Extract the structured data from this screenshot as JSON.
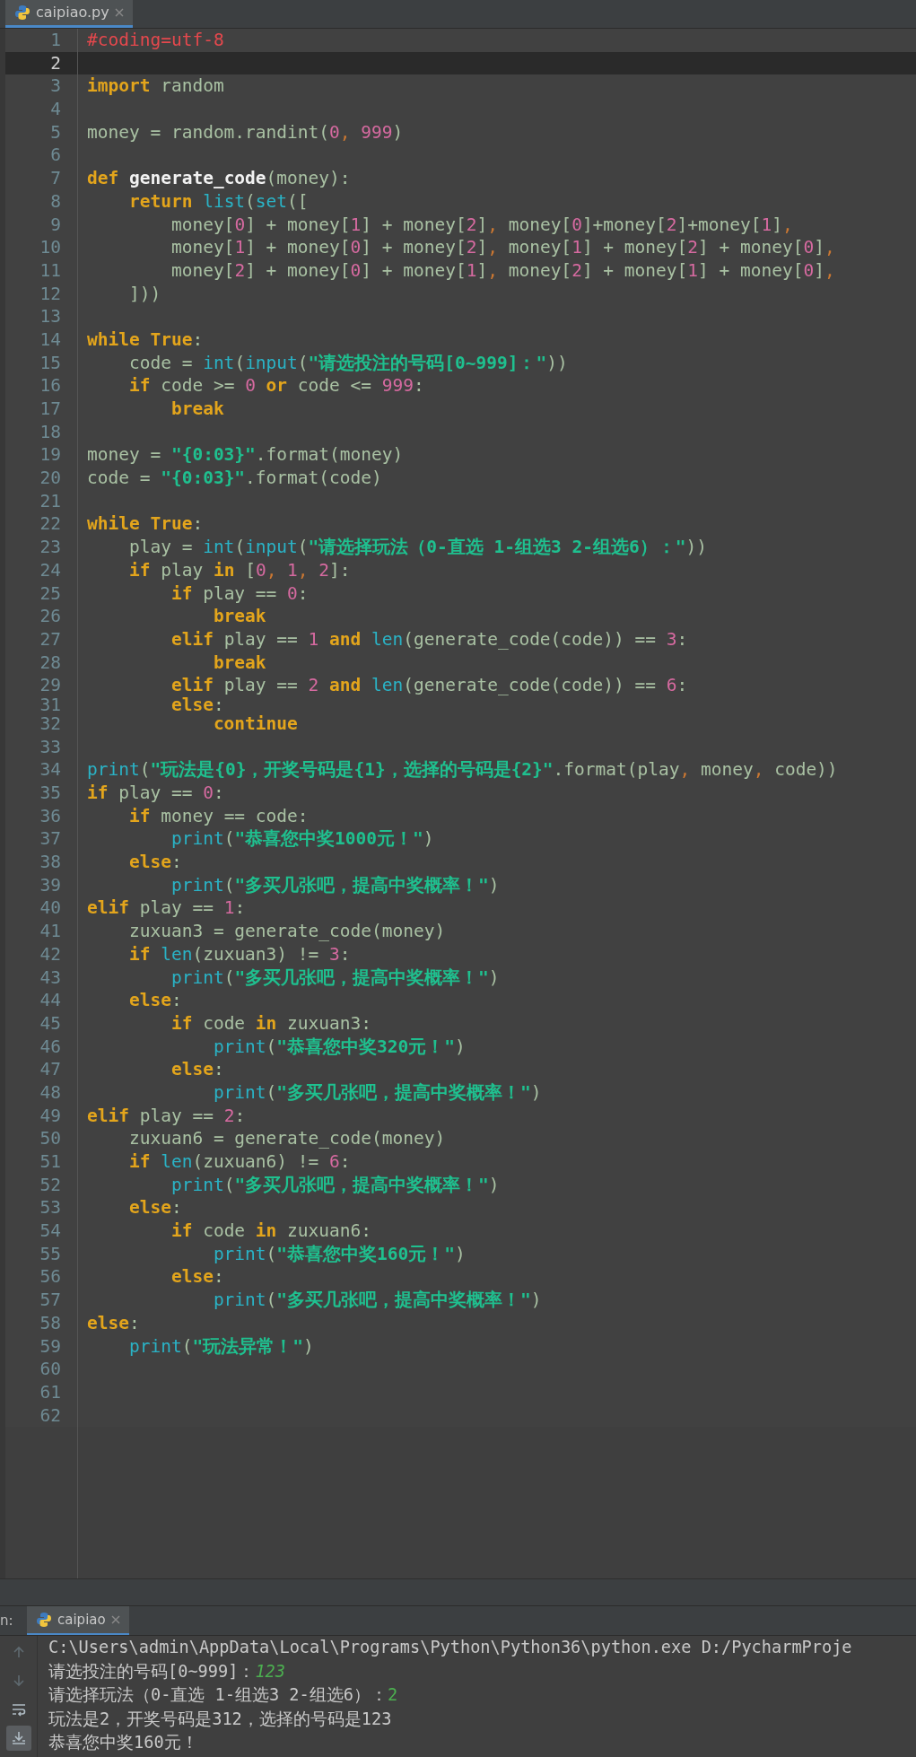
{
  "editor": {
    "tab": {
      "label": "caipiao.py",
      "selected": true
    },
    "lines": [
      {
        "n": "1",
        "current": false,
        "kind": "normal",
        "tokens": [
          {
            "kind": "comment",
            "text": "#coding=utf-8"
          }
        ]
      },
      {
        "n": "2",
        "current": true,
        "kind": "normal"
      },
      {
        "n": "3",
        "current": false,
        "kind": "normal",
        "tokens": [
          {
            "kind": "keyword",
            "text": "import"
          },
          {
            "kind": "plain",
            "text": " random"
          }
        ]
      },
      {
        "n": "4",
        "current": false,
        "kind": "normal"
      },
      {
        "n": "5",
        "current": false,
        "kind": "normal",
        "tokens": [
          {
            "kind": "plain",
            "text": "money = random.randint("
          },
          {
            "kind": "number",
            "text": "0"
          },
          {
            "kind": "comma",
            "text": ", "
          },
          {
            "kind": "number",
            "text": "999"
          },
          {
            "kind": "plain",
            "text": ")"
          }
        ]
      },
      {
        "n": "6",
        "current": false,
        "kind": "normal"
      },
      {
        "n": "7",
        "current": false,
        "kind": "normal",
        "tokens": [
          {
            "kind": "keyword",
            "text": "def"
          },
          {
            "kind": "defname",
            "text": " generate_code"
          },
          {
            "kind": "plain",
            "text": "(money):"
          }
        ]
      },
      {
        "n": "8",
        "current": false,
        "kind": "normal",
        "tokens": [
          {
            "kind": "keyword",
            "text": "    return"
          },
          {
            "kind": "builtin",
            "text": " list"
          },
          {
            "kind": "plain",
            "text": "("
          },
          {
            "kind": "builtin",
            "text": "set"
          },
          {
            "kind": "plain",
            "text": "(["
          }
        ]
      },
      {
        "n": "9",
        "current": false,
        "kind": "normal",
        "tokens": [
          {
            "kind": "plain",
            "text": "        money["
          },
          {
            "kind": "number",
            "text": "0"
          },
          {
            "kind": "plain",
            "text": "] + money["
          },
          {
            "kind": "number",
            "text": "1"
          },
          {
            "kind": "plain",
            "text": "] + money["
          },
          {
            "kind": "number",
            "text": "2"
          },
          {
            "kind": "plain",
            "text": "]"
          },
          {
            "kind": "comma",
            "text": ", "
          },
          {
            "kind": "plain",
            "text": "money["
          },
          {
            "kind": "number",
            "text": "0"
          },
          {
            "kind": "plain",
            "text": "]+money["
          },
          {
            "kind": "number",
            "text": "2"
          },
          {
            "kind": "plain",
            "text": "]+money["
          },
          {
            "kind": "number",
            "text": "1"
          },
          {
            "kind": "plain",
            "text": "]"
          },
          {
            "kind": "comma",
            "text": ","
          }
        ]
      },
      {
        "n": "10",
        "current": false,
        "kind": "normal",
        "tokens": [
          {
            "kind": "plain",
            "text": "        money["
          },
          {
            "kind": "number",
            "text": "1"
          },
          {
            "kind": "plain",
            "text": "] + money["
          },
          {
            "kind": "number",
            "text": "0"
          },
          {
            "kind": "plain",
            "text": "] + money["
          },
          {
            "kind": "number",
            "text": "2"
          },
          {
            "kind": "plain",
            "text": "]"
          },
          {
            "kind": "comma",
            "text": ", "
          },
          {
            "kind": "plain",
            "text": "money["
          },
          {
            "kind": "number",
            "text": "1"
          },
          {
            "kind": "plain",
            "text": "] + money["
          },
          {
            "kind": "number",
            "text": "2"
          },
          {
            "kind": "plain",
            "text": "] + money["
          },
          {
            "kind": "number",
            "text": "0"
          },
          {
            "kind": "plain",
            "text": "]"
          },
          {
            "kind": "comma",
            "text": ","
          }
        ]
      },
      {
        "n": "11",
        "current": false,
        "kind": "normal",
        "tokens": [
          {
            "kind": "plain",
            "text": "        money["
          },
          {
            "kind": "number",
            "text": "2"
          },
          {
            "kind": "plain",
            "text": "] + money["
          },
          {
            "kind": "number",
            "text": "0"
          },
          {
            "kind": "plain",
            "text": "] + money["
          },
          {
            "kind": "number",
            "text": "1"
          },
          {
            "kind": "plain",
            "text": "]"
          },
          {
            "kind": "comma",
            "text": ", "
          },
          {
            "kind": "plain",
            "text": "money["
          },
          {
            "kind": "number",
            "text": "2"
          },
          {
            "kind": "plain",
            "text": "] + money["
          },
          {
            "kind": "number",
            "text": "1"
          },
          {
            "kind": "plain",
            "text": "] + money["
          },
          {
            "kind": "number",
            "text": "0"
          },
          {
            "kind": "plain",
            "text": "]"
          },
          {
            "kind": "comma",
            "text": ","
          }
        ]
      },
      {
        "n": "12",
        "current": false,
        "kind": "normal",
        "tokens": [
          {
            "kind": "plain",
            "text": "    ]))"
          }
        ]
      },
      {
        "n": "13",
        "current": false,
        "kind": "normal"
      },
      {
        "n": "14",
        "current": false,
        "kind": "normal",
        "tokens": [
          {
            "kind": "keyword",
            "text": "while"
          },
          {
            "kind": "keyword",
            "text": " True"
          },
          {
            "kind": "plain",
            "text": ":"
          }
        ]
      },
      {
        "n": "15",
        "current": false,
        "kind": "normal",
        "tokens": [
          {
            "kind": "plain",
            "text": "    code = "
          },
          {
            "kind": "builtin",
            "text": "int"
          },
          {
            "kind": "plain",
            "text": "("
          },
          {
            "kind": "builtin",
            "text": "input"
          },
          {
            "kind": "plain",
            "text": "("
          },
          {
            "kind": "string",
            "text": "\"请选投注的号码[0~999]：\""
          },
          {
            "kind": "plain",
            "text": "))"
          }
        ]
      },
      {
        "n": "16",
        "current": false,
        "kind": "normal",
        "tokens": [
          {
            "kind": "keyword",
            "text": "    if"
          },
          {
            "kind": "plain",
            "text": " code >= "
          },
          {
            "kind": "number",
            "text": "0"
          },
          {
            "kind": "keyword",
            "text": " or"
          },
          {
            "kind": "plain",
            "text": " code <= "
          },
          {
            "kind": "number",
            "text": "999"
          },
          {
            "kind": "plain",
            "text": ":"
          }
        ]
      },
      {
        "n": "17",
        "current": false,
        "kind": "normal",
        "tokens": [
          {
            "kind": "keyword",
            "text": "        break"
          }
        ]
      },
      {
        "n": "18",
        "current": false,
        "kind": "normal"
      },
      {
        "n": "19",
        "current": false,
        "kind": "normal",
        "tokens": [
          {
            "kind": "plain",
            "text": "money = "
          },
          {
            "kind": "string",
            "text": "\"{0:03}\""
          },
          {
            "kind": "plain",
            "text": ".format(money)"
          }
        ]
      },
      {
        "n": "20",
        "current": false,
        "kind": "normal",
        "tokens": [
          {
            "kind": "plain",
            "text": "code = "
          },
          {
            "kind": "string",
            "text": "\"{0:03}\""
          },
          {
            "kind": "plain",
            "text": ".format(code)"
          }
        ]
      },
      {
        "n": "21",
        "current": false,
        "kind": "normal"
      },
      {
        "n": "22",
        "current": false,
        "kind": "normal",
        "tokens": [
          {
            "kind": "keyword",
            "text": "while"
          },
          {
            "kind": "keyword",
            "text": " True"
          },
          {
            "kind": "plain",
            "text": ":"
          }
        ]
      },
      {
        "n": "23",
        "current": false,
        "kind": "normal",
        "tokens": [
          {
            "kind": "plain",
            "text": "    play = "
          },
          {
            "kind": "builtin",
            "text": "int"
          },
          {
            "kind": "plain",
            "text": "("
          },
          {
            "kind": "builtin",
            "text": "input"
          },
          {
            "kind": "plain",
            "text": "("
          },
          {
            "kind": "string",
            "text": "\"请选择玩法（0-直选 1-组选3 2-组选6）：\""
          },
          {
            "kind": "plain",
            "text": "))"
          }
        ]
      },
      {
        "n": "24",
        "current": false,
        "kind": "normal",
        "tokens": [
          {
            "kind": "keyword",
            "text": "    if"
          },
          {
            "kind": "plain",
            "text": " play "
          },
          {
            "kind": "keyword",
            "text": "in"
          },
          {
            "kind": "plain",
            "text": " ["
          },
          {
            "kind": "number",
            "text": "0"
          },
          {
            "kind": "comma",
            "text": ", "
          },
          {
            "kind": "number",
            "text": "1"
          },
          {
            "kind": "comma",
            "text": ", "
          },
          {
            "kind": "number",
            "text": "2"
          },
          {
            "kind": "plain",
            "text": "]:"
          }
        ]
      },
      {
        "n": "25",
        "current": false,
        "kind": "normal",
        "tokens": [
          {
            "kind": "keyword",
            "text": "        if"
          },
          {
            "kind": "plain",
            "text": " play == "
          },
          {
            "kind": "number",
            "text": "0"
          },
          {
            "kind": "plain",
            "text": ":"
          }
        ]
      },
      {
        "n": "26",
        "current": false,
        "kind": "normal",
        "tokens": [
          {
            "kind": "keyword",
            "text": "            break"
          }
        ]
      },
      {
        "n": "27",
        "current": false,
        "kind": "normal",
        "tokens": [
          {
            "kind": "keyword",
            "text": "        elif"
          },
          {
            "kind": "plain",
            "text": " play == "
          },
          {
            "kind": "number",
            "text": "1"
          },
          {
            "kind": "keyword",
            "text": " and"
          },
          {
            "kind": "builtin",
            "text": " len"
          },
          {
            "kind": "plain",
            "text": "(generate_code(code)) == "
          },
          {
            "kind": "number",
            "text": "3"
          },
          {
            "kind": "plain",
            "text": ":"
          }
        ]
      },
      {
        "n": "28",
        "current": false,
        "kind": "normal",
        "tokens": [
          {
            "kind": "keyword",
            "text": "            break"
          }
        ]
      },
      {
        "n": "29",
        "current": false,
        "kind": "normal",
        "tokens": [
          {
            "kind": "keyword",
            "text": "        elif"
          },
          {
            "kind": "plain",
            "text": " play == "
          },
          {
            "kind": "number",
            "text": "2"
          },
          {
            "kind": "keyword",
            "text": " and"
          },
          {
            "kind": "builtin",
            "text": " len"
          },
          {
            "kind": "plain",
            "text": "(generate_code(code)) == "
          },
          {
            "kind": "number",
            "text": "6"
          },
          {
            "kind": "plain",
            "text": ":"
          }
        ]
      },
      {
        "n": "31",
        "current": false,
        "kind": "squeezed",
        "tokens": [
          {
            "kind": "keyword",
            "text": "        else"
          },
          {
            "kind": "plain",
            "text": ":"
          }
        ]
      },
      {
        "n": "32",
        "current": false,
        "kind": "normal",
        "tokens": [
          {
            "kind": "keyword",
            "text": "            continue"
          }
        ]
      },
      {
        "n": "33",
        "current": false,
        "kind": "normal"
      },
      {
        "n": "34",
        "current": false,
        "kind": "normal",
        "tokens": [
          {
            "kind": "builtin",
            "text": "print"
          },
          {
            "kind": "plain",
            "text": "("
          },
          {
            "kind": "string",
            "text": "\"玩法是{0}，开奖号码是{1}，选择的号码是{2}\""
          },
          {
            "kind": "plain",
            "text": ".format(play"
          },
          {
            "kind": "comma",
            "text": ", "
          },
          {
            "kind": "plain",
            "text": "money"
          },
          {
            "kind": "comma",
            "text": ", "
          },
          {
            "kind": "plain",
            "text": "code))"
          }
        ]
      },
      {
        "n": "35",
        "current": false,
        "kind": "normal",
        "tokens": [
          {
            "kind": "keyword",
            "text": "if"
          },
          {
            "kind": "plain",
            "text": " play == "
          },
          {
            "kind": "number",
            "text": "0"
          },
          {
            "kind": "plain",
            "text": ":"
          }
        ]
      },
      {
        "n": "36",
        "current": false,
        "kind": "normal",
        "tokens": [
          {
            "kind": "keyword",
            "text": "    if"
          },
          {
            "kind": "plain",
            "text": " money == code:"
          }
        ]
      },
      {
        "n": "37",
        "current": false,
        "kind": "normal",
        "tokens": [
          {
            "kind": "builtin",
            "text": "        print"
          },
          {
            "kind": "plain",
            "text": "("
          },
          {
            "kind": "string",
            "text": "\"恭喜您中奖1000元！\""
          },
          {
            "kind": "plain",
            "text": ")"
          }
        ]
      },
      {
        "n": "38",
        "current": false,
        "kind": "normal",
        "tokens": [
          {
            "kind": "keyword",
            "text": "    else"
          },
          {
            "kind": "plain",
            "text": ":"
          }
        ]
      },
      {
        "n": "39",
        "current": false,
        "kind": "normal",
        "tokens": [
          {
            "kind": "builtin",
            "text": "        print"
          },
          {
            "kind": "plain",
            "text": "("
          },
          {
            "kind": "string",
            "text": "\"多买几张吧，提高中奖概率！\""
          },
          {
            "kind": "plain",
            "text": ")"
          }
        ]
      },
      {
        "n": "40",
        "current": false,
        "kind": "normal",
        "tokens": [
          {
            "kind": "keyword",
            "text": "elif"
          },
          {
            "kind": "plain",
            "text": " play == "
          },
          {
            "kind": "number",
            "text": "1"
          },
          {
            "kind": "plain",
            "text": ":"
          }
        ]
      },
      {
        "n": "41",
        "current": false,
        "kind": "normal",
        "tokens": [
          {
            "kind": "plain",
            "text": "    zuxuan3 = generate_code(money)"
          }
        ]
      },
      {
        "n": "42",
        "current": false,
        "kind": "normal",
        "tokens": [
          {
            "kind": "keyword",
            "text": "    if"
          },
          {
            "kind": "builtin",
            "text": " len"
          },
          {
            "kind": "plain",
            "text": "(zuxuan3) != "
          },
          {
            "kind": "number",
            "text": "3"
          },
          {
            "kind": "plain",
            "text": ":"
          }
        ]
      },
      {
        "n": "43",
        "current": false,
        "kind": "normal",
        "tokens": [
          {
            "kind": "builtin",
            "text": "        print"
          },
          {
            "kind": "plain",
            "text": "("
          },
          {
            "kind": "string",
            "text": "\"多买几张吧，提高中奖概率！\""
          },
          {
            "kind": "plain",
            "text": ")"
          }
        ]
      },
      {
        "n": "44",
        "current": false,
        "kind": "normal",
        "tokens": [
          {
            "kind": "keyword",
            "text": "    else"
          },
          {
            "kind": "plain",
            "text": ":"
          }
        ]
      },
      {
        "n": "45",
        "current": false,
        "kind": "normal",
        "tokens": [
          {
            "kind": "keyword",
            "text": "        if"
          },
          {
            "kind": "plain",
            "text": " code "
          },
          {
            "kind": "keyword",
            "text": "in"
          },
          {
            "kind": "plain",
            "text": " zuxuan3:"
          }
        ]
      },
      {
        "n": "46",
        "current": false,
        "kind": "normal",
        "tokens": [
          {
            "kind": "builtin",
            "text": "            print"
          },
          {
            "kind": "plain",
            "text": "("
          },
          {
            "kind": "string",
            "text": "\"恭喜您中奖320元！\""
          },
          {
            "kind": "plain",
            "text": ")"
          }
        ]
      },
      {
        "n": "47",
        "current": false,
        "kind": "normal",
        "tokens": [
          {
            "kind": "keyword",
            "text": "        else"
          },
          {
            "kind": "plain",
            "text": ":"
          }
        ]
      },
      {
        "n": "48",
        "current": false,
        "kind": "normal",
        "tokens": [
          {
            "kind": "builtin",
            "text": "            print"
          },
          {
            "kind": "plain",
            "text": "("
          },
          {
            "kind": "string",
            "text": "\"多买几张吧，提高中奖概率！\""
          },
          {
            "kind": "plain",
            "text": ")"
          }
        ]
      },
      {
        "n": "49",
        "current": false,
        "kind": "normal",
        "tokens": [
          {
            "kind": "keyword",
            "text": "elif"
          },
          {
            "kind": "plain",
            "text": " play == "
          },
          {
            "kind": "number",
            "text": "2"
          },
          {
            "kind": "plain",
            "text": ":"
          }
        ]
      },
      {
        "n": "50",
        "current": false,
        "kind": "normal",
        "tokens": [
          {
            "kind": "plain",
            "text": "    zuxuan6 = generate_code(money)"
          }
        ]
      },
      {
        "n": "51",
        "current": false,
        "kind": "normal",
        "tokens": [
          {
            "kind": "keyword",
            "text": "    if"
          },
          {
            "kind": "builtin",
            "text": " len"
          },
          {
            "kind": "plain",
            "text": "(zuxuan6) != "
          },
          {
            "kind": "number",
            "text": "6"
          },
          {
            "kind": "plain",
            "text": ":"
          }
        ]
      },
      {
        "n": "52",
        "current": false,
        "kind": "normal",
        "tokens": [
          {
            "kind": "builtin",
            "text": "        print"
          },
          {
            "kind": "plain",
            "text": "("
          },
          {
            "kind": "string",
            "text": "\"多买几张吧，提高中奖概率！\""
          },
          {
            "kind": "plain",
            "text": ")"
          }
        ]
      },
      {
        "n": "53",
        "current": false,
        "kind": "normal",
        "tokens": [
          {
            "kind": "keyword",
            "text": "    else"
          },
          {
            "kind": "plain",
            "text": ":"
          }
        ]
      },
      {
        "n": "54",
        "current": false,
        "kind": "normal",
        "tokens": [
          {
            "kind": "keyword",
            "text": "        if"
          },
          {
            "kind": "plain",
            "text": " code "
          },
          {
            "kind": "keyword",
            "text": "in"
          },
          {
            "kind": "plain",
            "text": " zuxuan6:"
          }
        ]
      },
      {
        "n": "55",
        "current": false,
        "kind": "normal",
        "tokens": [
          {
            "kind": "builtin",
            "text": "            print"
          },
          {
            "kind": "plain",
            "text": "("
          },
          {
            "kind": "string",
            "text": "\"恭喜您中奖160元！\""
          },
          {
            "kind": "plain",
            "text": ")"
          }
        ]
      },
      {
        "n": "56",
        "current": false,
        "kind": "normal",
        "tokens": [
          {
            "kind": "keyword",
            "text": "        else"
          },
          {
            "kind": "plain",
            "text": ":"
          }
        ]
      },
      {
        "n": "57",
        "current": false,
        "kind": "normal",
        "tokens": [
          {
            "kind": "builtin",
            "text": "            print"
          },
          {
            "kind": "plain",
            "text": "("
          },
          {
            "kind": "string",
            "text": "\"多买几张吧，提高中奖概率！\""
          },
          {
            "kind": "plain",
            "text": ")"
          }
        ]
      },
      {
        "n": "58",
        "current": false,
        "kind": "normal",
        "tokens": [
          {
            "kind": "keyword",
            "text": "else"
          },
          {
            "kind": "plain",
            "text": ":"
          }
        ]
      },
      {
        "n": "59",
        "current": false,
        "kind": "normal",
        "tokens": [
          {
            "kind": "builtin",
            "text": "    print"
          },
          {
            "kind": "plain",
            "text": "("
          },
          {
            "kind": "string",
            "text": "\"玩法异常！\""
          },
          {
            "kind": "plain",
            "text": ")"
          }
        ]
      },
      {
        "n": "60",
        "current": false,
        "kind": "normal"
      },
      {
        "n": "61",
        "current": false,
        "kind": "normal"
      },
      {
        "n": "62",
        "current": false,
        "kind": "normal"
      }
    ]
  },
  "run_panel": {
    "label": "n:",
    "tab": {
      "label": "caipiao",
      "selected": true
    },
    "toolbar": [
      {
        "kind": "up",
        "disabled": true,
        "on": false
      },
      {
        "kind": "down",
        "disabled": true,
        "on": false
      },
      {
        "kind": "wrap",
        "disabled": false,
        "on": false
      },
      {
        "kind": "scroll_end",
        "disabled": false,
        "on": true
      }
    ],
    "console": [
      {
        "tokens": [
          {
            "kind": "output",
            "text": "C:\\Users\\admin\\AppData\\Local\\Programs\\Python\\Python36\\python.exe D:/PycharmProje"
          }
        ]
      },
      {
        "tokens": [
          {
            "kind": "output",
            "text": "请选投注的号码[0~999]："
          },
          {
            "kind": "input",
            "text": "123"
          }
        ]
      },
      {
        "tokens": [
          {
            "kind": "output",
            "text": "请选择玩法（0-直选 1-组选3 2-组选6）："
          },
          {
            "kind": "answer",
            "text": "2"
          }
        ]
      },
      {
        "tokens": [
          {
            "kind": "output",
            "text": "玩法是2，开奖号码是312，选择的号码是123"
          }
        ]
      },
      {
        "tokens": [
          {
            "kind": "output",
            "text": "恭喜您中奖160元！"
          }
        ]
      }
    ]
  }
}
